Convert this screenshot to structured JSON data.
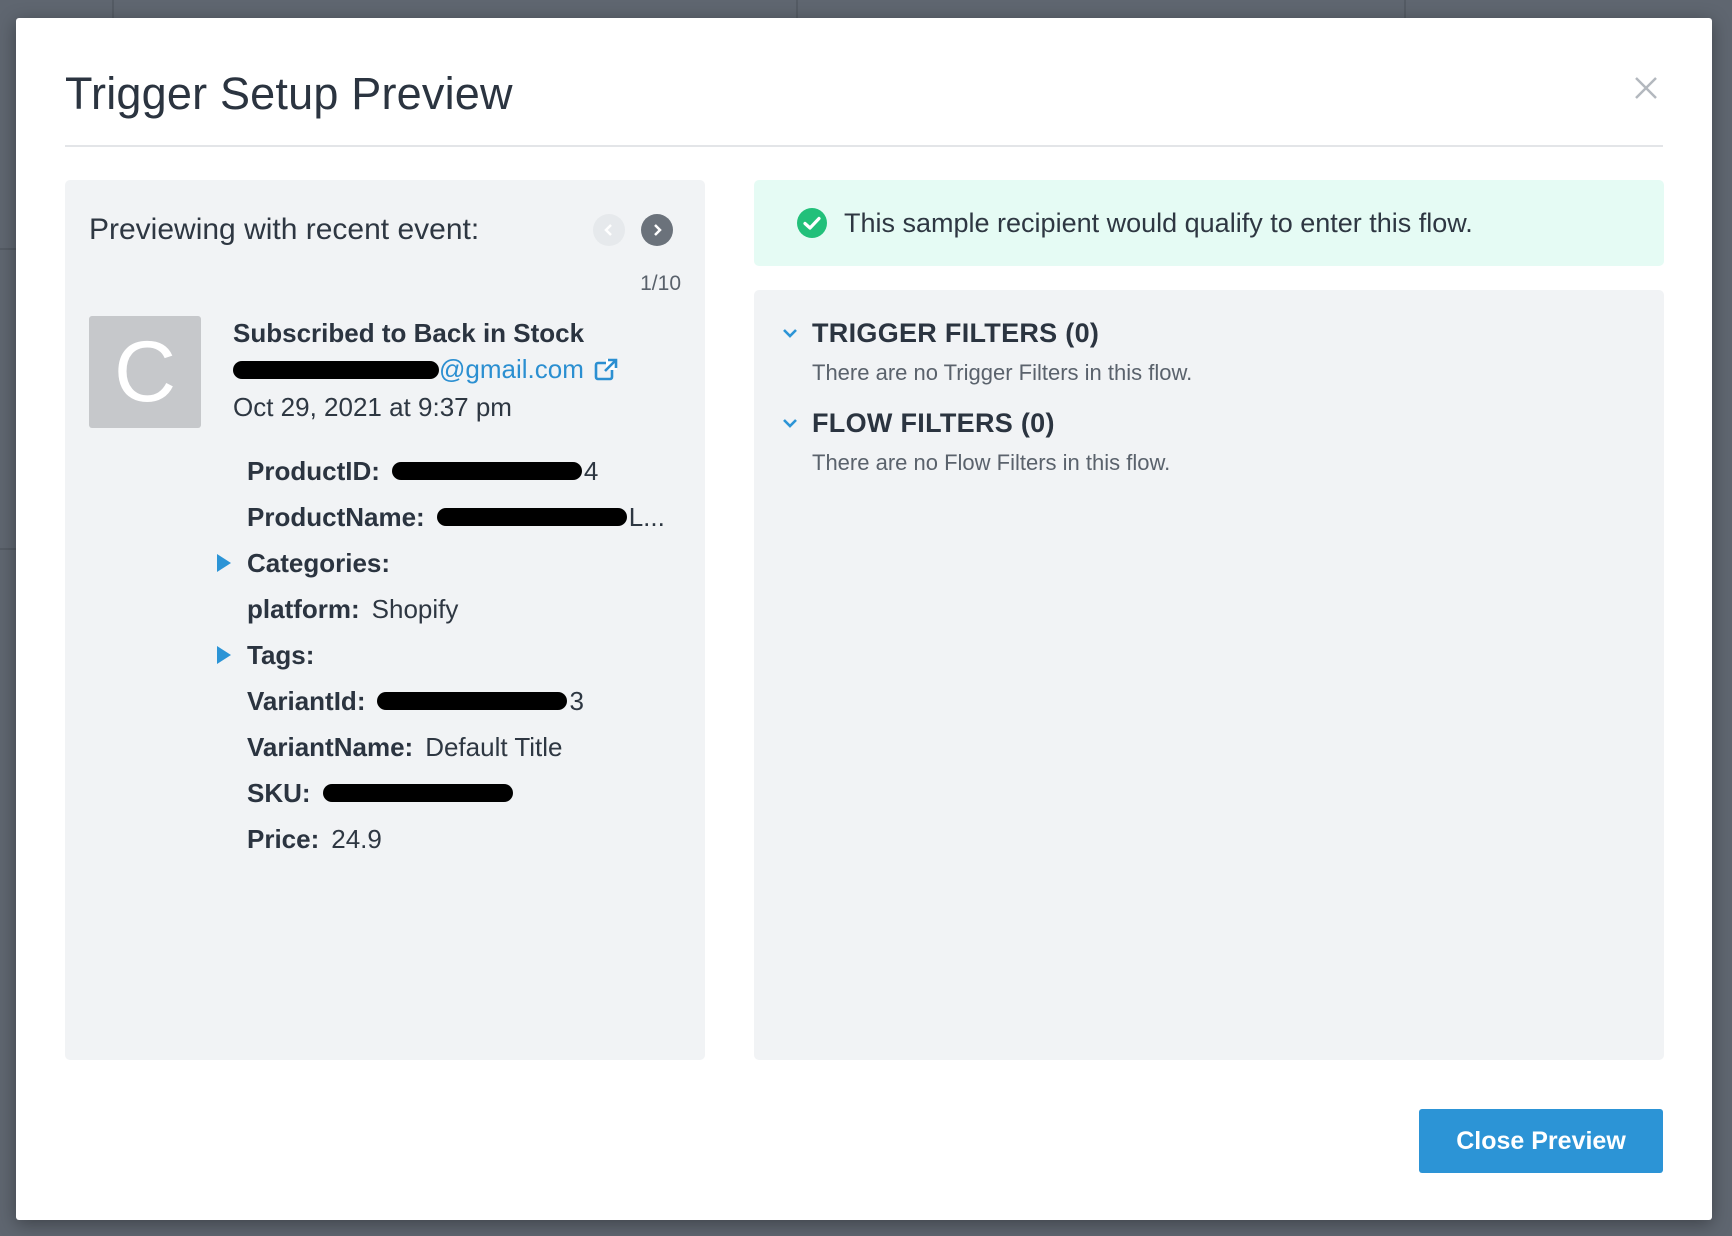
{
  "modal": {
    "title": "Trigger Setup Preview",
    "close_icon": "close-x-icon",
    "close_button_label": "Close Preview"
  },
  "event_preview": {
    "label": "Previewing with recent event:",
    "counter": "1/10",
    "avatar_letter": "C",
    "event_name": "Subscribed to Back in Stock",
    "email_visible_suffix": "@gmail.com",
    "date": "Oct 29, 2021 at 9:37 pm",
    "properties": [
      {
        "key": "ProductID:",
        "value": "4",
        "redacted": true,
        "expandable": false
      },
      {
        "key": "ProductName:",
        "value": "L...",
        "redacted": true,
        "expandable": false
      },
      {
        "key": "Categories:",
        "value": "",
        "redacted": false,
        "expandable": true
      },
      {
        "key": "platform:",
        "value": "Shopify",
        "redacted": false,
        "expandable": false
      },
      {
        "key": "Tags:",
        "value": "",
        "redacted": false,
        "expandable": true
      },
      {
        "key": "VariantId:",
        "value": "3",
        "redacted": true,
        "expandable": false
      },
      {
        "key": "VariantName:",
        "value": "Default Title",
        "redacted": false,
        "expandable": false
      },
      {
        "key": "SKU:",
        "value": "",
        "redacted": true,
        "expandable": false
      },
      {
        "key": "Price:",
        "value": "24.9",
        "redacted": false,
        "expandable": false
      }
    ]
  },
  "result": {
    "message": "This sample recipient would qualify to enter this flow.",
    "status_color": "#22c07a"
  },
  "filters": {
    "trigger": {
      "title": "TRIGGER FILTERS (0)",
      "description": "There are no Trigger Filters in this flow."
    },
    "flow": {
      "title": "FLOW FILTERS (0)",
      "description": "There are no Flow Filters in this flow."
    }
  },
  "colors": {
    "accent": "#2c94d6",
    "success_bg": "#e5fbf4",
    "panel_bg": "#f1f3f5"
  }
}
